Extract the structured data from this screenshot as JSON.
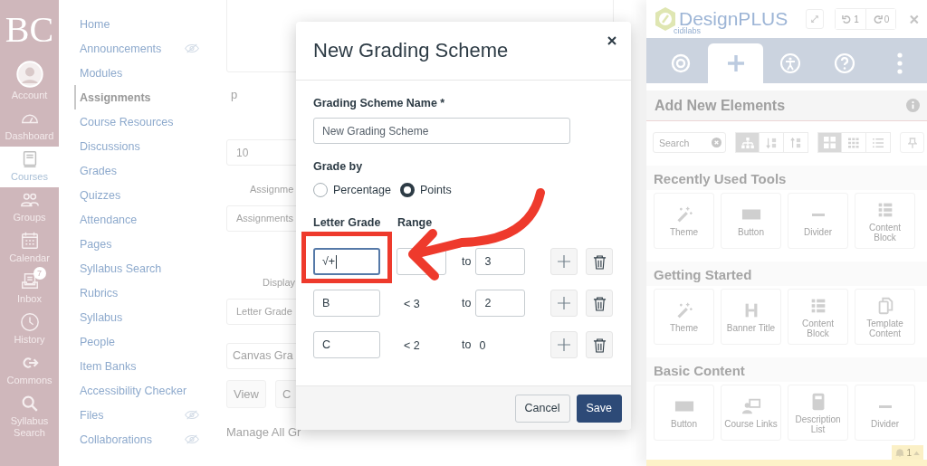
{
  "global_nav": {
    "logo": "BC",
    "items": [
      {
        "label": "Account",
        "selected": false
      },
      {
        "label": "Dashboard",
        "selected": false
      },
      {
        "label": "Courses",
        "selected": true
      },
      {
        "label": "Groups",
        "selected": false
      },
      {
        "label": "Calendar",
        "selected": false
      },
      {
        "label": "Inbox",
        "selected": false,
        "badge": "7"
      },
      {
        "label": "History",
        "selected": false
      },
      {
        "label": "Commons",
        "selected": false
      },
      {
        "label": "Syllabus Search",
        "selected": false
      }
    ]
  },
  "course_nav": {
    "items": [
      {
        "label": "Home",
        "selected": false,
        "hidden": false
      },
      {
        "label": "Announcements",
        "selected": false,
        "hidden": true
      },
      {
        "label": "Modules",
        "selected": false,
        "hidden": false
      },
      {
        "label": "Assignments",
        "selected": true,
        "hidden": false
      },
      {
        "label": "Course Resources",
        "selected": false,
        "hidden": false
      },
      {
        "label": "Discussions",
        "selected": false,
        "hidden": false
      },
      {
        "label": "Grades",
        "selected": false,
        "hidden": false
      },
      {
        "label": "Quizzes",
        "selected": false,
        "hidden": false
      },
      {
        "label": "Attendance",
        "selected": false,
        "hidden": false
      },
      {
        "label": "Pages",
        "selected": false,
        "hidden": false
      },
      {
        "label": "Syllabus Search",
        "selected": false,
        "hidden": false
      },
      {
        "label": "Rubrics",
        "selected": false,
        "hidden": false
      },
      {
        "label": "Syllabus",
        "selected": false,
        "hidden": false
      },
      {
        "label": "People",
        "selected": false,
        "hidden": false
      },
      {
        "label": "Item Banks",
        "selected": false,
        "hidden": false
      },
      {
        "label": "Accessibility Checker",
        "selected": false,
        "hidden": false
      },
      {
        "label": "Files",
        "selected": false,
        "hidden": true
      },
      {
        "label": "Collaborations",
        "selected": false,
        "hidden": true
      }
    ]
  },
  "page_form": {
    "element_path": "p",
    "points": "10",
    "group_label": "Assignme",
    "group_value": "Assignments",
    "display_label": "Display",
    "display_value": "Letter Grade",
    "scheme_value": "Canvas Gra",
    "buttons": [
      "View",
      "C"
    ],
    "link": "Manage All Gr"
  },
  "modal": {
    "title": "New Grading Scheme",
    "name_label": "Grading Scheme Name *",
    "name_value": "New Grading Scheme",
    "grade_by_label": "Grade by",
    "grade_by": [
      {
        "label": "Percentage",
        "selected": false
      },
      {
        "label": "Points",
        "selected": true
      }
    ],
    "columns": [
      "Letter Grade",
      "Range"
    ],
    "rows": [
      {
        "letter": "√+",
        "focused": true,
        "start": {
          "kind": "input"
        },
        "to": "to",
        "end": {
          "kind": "input",
          "text": "3"
        }
      },
      {
        "letter": "B",
        "focused": false,
        "start": {
          "kind": "text",
          "text": "< 3"
        },
        "to": "to",
        "end": {
          "kind": "input",
          "text": "2"
        }
      },
      {
        "letter": "C",
        "focused": false,
        "start": {
          "kind": "text",
          "text": "< 2"
        },
        "to": "to",
        "end": {
          "kind": "text",
          "text": "0"
        }
      }
    ],
    "buttons": [
      {
        "label": "Cancel",
        "kind": "secondary"
      },
      {
        "label": "Save",
        "kind": "primary"
      }
    ]
  },
  "design_panel": {
    "brand": "DesignPLUS",
    "brand_sub": "cidilabs",
    "undo_count": "1",
    "redo_count": "0",
    "tabs": [
      {
        "selected": false
      },
      {
        "selected": true
      },
      {
        "selected": false
      },
      {
        "selected": false
      },
      {
        "selected": false
      }
    ],
    "section_title": "Add New Elements",
    "search": {
      "placeholder": "Search"
    },
    "sort_buttons": [
      {
        "selected": true
      },
      {
        "selected": false
      },
      {
        "selected": false
      }
    ],
    "view_buttons": [
      {
        "selected": true
      },
      {
        "selected": false
      },
      {
        "selected": false
      }
    ],
    "groups": [
      {
        "title": "Recently Used Tools",
        "tools": [
          {
            "label": "Theme",
            "kind": "theme"
          },
          {
            "label": "Button",
            "kind": "button"
          },
          {
            "label": "Divider",
            "kind": "divider"
          },
          {
            "label": "Content Block",
            "kind": "block"
          }
        ]
      },
      {
        "title": "Getting Started",
        "tools": [
          {
            "label": "Theme",
            "kind": "theme"
          },
          {
            "label": "Banner Title",
            "kind": "heading"
          },
          {
            "label": "Content Block",
            "kind": "block"
          },
          {
            "label": "Template Content",
            "kind": "template"
          }
        ]
      },
      {
        "title": "Basic Content",
        "tools": [
          {
            "label": "Button",
            "kind": "button"
          },
          {
            "label": "Course Links",
            "kind": "links"
          },
          {
            "label": "Description List",
            "kind": "list"
          },
          {
            "label": "Divider",
            "kind": "divider"
          }
        ]
      }
    ],
    "notification_count": "1"
  }
}
